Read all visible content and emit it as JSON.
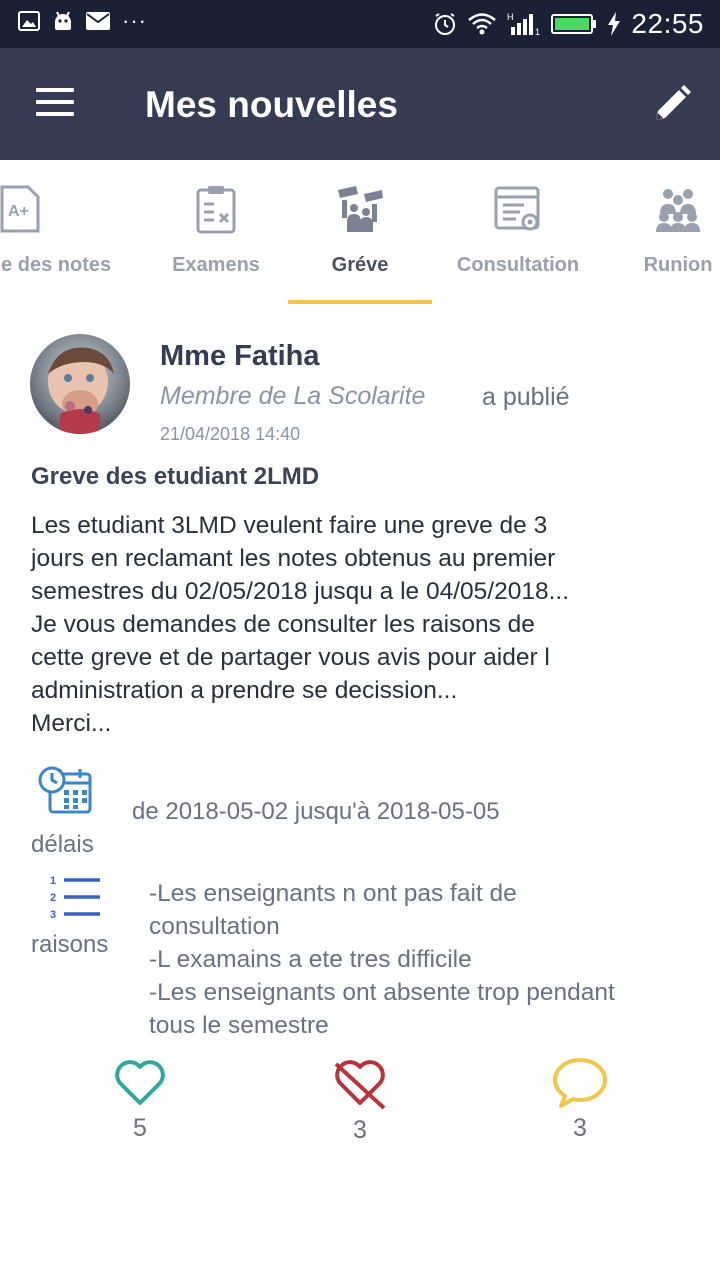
{
  "status_bar": {
    "time": "22:55",
    "overflow": "···",
    "colors": {
      "battery": "#4cd964",
      "background": "#1b2135"
    },
    "icons": [
      "gallery-icon",
      "android-icon",
      "mail-icon",
      "alarm-icon",
      "wifi-icon",
      "signal-icon",
      "battery-icon",
      "charging-icon"
    ]
  },
  "app_bar": {
    "title": "Mes nouvelles",
    "background": "#343b52",
    "icons": [
      "menu-icon",
      "edit-icon"
    ]
  },
  "tabs": {
    "items": [
      {
        "label": "ge des notes",
        "icon": "grade-sheet-icon",
        "active": false
      },
      {
        "label": "Examens",
        "icon": "exam-clipboard-icon",
        "active": false
      },
      {
        "label": "Gréve",
        "icon": "strike-icon",
        "active": true
      },
      {
        "label": "Consultation",
        "icon": "consultation-icon",
        "active": false
      },
      {
        "label": "Runion",
        "icon": "meeting-icon",
        "active": false
      }
    ],
    "accent": "#f3c64b"
  },
  "post": {
    "author": "Mme Fatiha",
    "role": "Membre de La Scolarite",
    "published": "a publié",
    "date": "21/04/2018 14:40",
    "title": "Greve des etudiant 2LMD",
    "body": "Les etudiant 3LMD veulent faire une greve de 3\njours en reclamant les notes obtenus au premier\nsemestres du 02/05/2018 jusqu a le 04/05/2018...\nJe vous demandes de consulter les raisons de\ncette greve et de partager vous avis pour aider l\nadministration a prendre se decission...\nMerci...",
    "delai": {
      "label": "délais",
      "value": "de 2018-05-02 jusqu'à 2018-05-05",
      "icon": "calendar-clock-icon"
    },
    "raisons": {
      "label": "raisons",
      "icon": "numbered-list-icon",
      "text": "-Les enseignants n ont pas fait de\nconsultation\n-L examains a ete tres difficile\n-Les enseignants ont absente trop pendant\ntous le semestre"
    }
  },
  "actions": {
    "likes": {
      "count": "5",
      "icon": "heart-icon",
      "color": "#2fa9a0"
    },
    "dislikes": {
      "count": "3",
      "icon": "broken-heart-icon",
      "color": "#b8343a"
    },
    "comments": {
      "count": "3",
      "icon": "comment-icon",
      "color": "#f3c64b"
    }
  }
}
